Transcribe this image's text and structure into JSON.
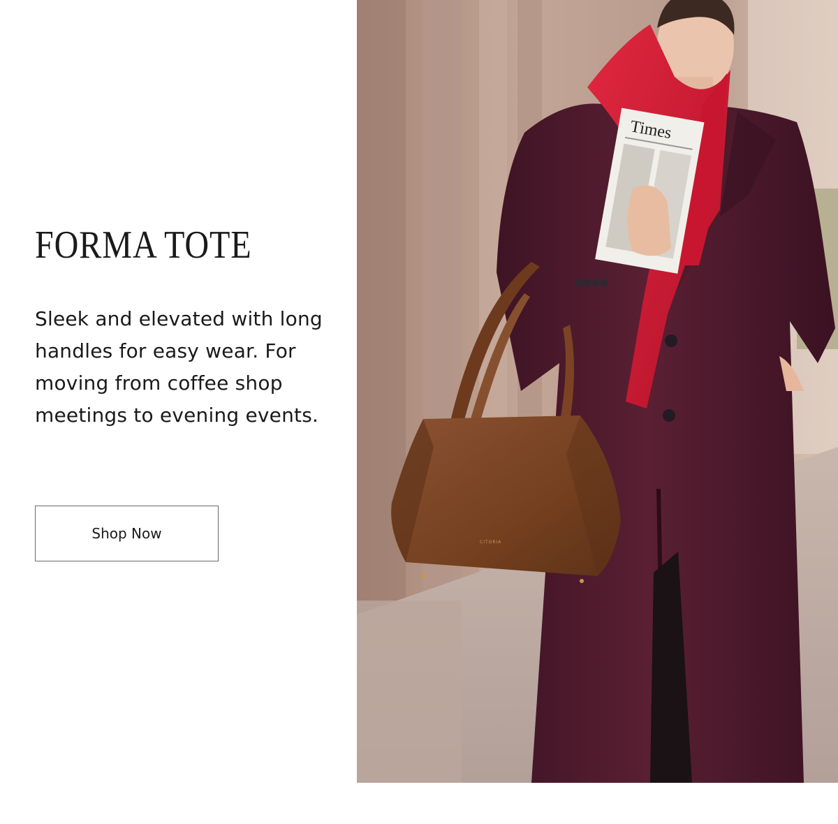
{
  "promo": {
    "title": "FORMA TOTE",
    "description": "Sleek and elevated with long handles for easy wear. For moving from coffee shop meetings to evening events.",
    "cta_label": "Shop Now"
  },
  "hero_image": {
    "alt": "Woman in a burgundy coat and red scarf holding a newspaper, carrying a brown leather tote bag on her shoulder",
    "newspaper_masthead": "Times",
    "bag_stamp": "CITORIA"
  },
  "colors": {
    "text": "#1a1a1a",
    "button_border": "#6b6b6b",
    "coat": "#4a1a2c",
    "scarf": "#cf1731",
    "bag": "#7a4427"
  }
}
